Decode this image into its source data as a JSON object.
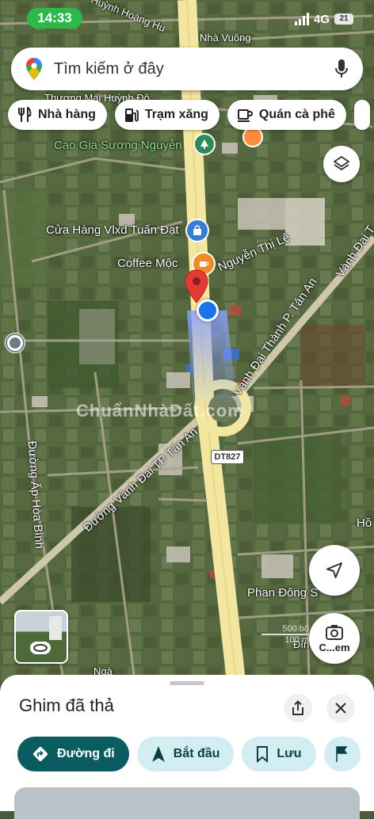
{
  "status_bar": {
    "time": "14:33",
    "network": "4G",
    "battery": "21"
  },
  "search": {
    "placeholder": "Tìm kiếm ở đây"
  },
  "chips": [
    {
      "label": "Nhà hàng",
      "icon": "fork-knife-icon"
    },
    {
      "label": "Trạm xăng",
      "icon": "gas-station-icon"
    },
    {
      "label": "Quán cà phê",
      "icon": "coffee-cup-icon"
    }
  ],
  "map": {
    "labels": {
      "huynh_hoang": "Huỳnh Hoàng Hu",
      "nha_vuong": "Nhà Vuông",
      "thuong_mai": "Thương Mại Huỳnh Đô",
      "cao_gia": "Cao Gia Sương Nguyễn",
      "cua_hang": "Cửa Hàng Vlxd Tuấn Đạt",
      "coffee": "Coffee Mộc",
      "nguyen_thi_le": "Nguyễn Thị Lệ",
      "vanh_dai_1": "Vành Đai Thành P. Tân An",
      "vanh_dai_2": "Vành Đai T",
      "vanh_dai_3": "Đường Vành Đai TP Tân An",
      "ap_hoa_binh": "Đường Ấp Hòa Bình",
      "phan_dong": "Phan Đông S",
      "ho": "Hồ",
      "dinh": "Đìn",
      "nga": "Ngà",
      "road_badge": "DT827",
      "scale_1": "500 bộ",
      "scale_2": "100 m"
    },
    "watermark": "ChuẩnNhàĐất.com",
    "camera_button": "C...em"
  },
  "sheet": {
    "title": "Ghim đã thả",
    "actions": [
      {
        "label": "Đường đi",
        "icon": "directions-icon"
      },
      {
        "label": "Bắt đầu",
        "icon": "navigation-arrow-icon"
      },
      {
        "label": "Lưu",
        "icon": "bookmark-icon"
      }
    ]
  },
  "colors": {
    "accent_teal": "#0b5c60",
    "chip_light": "#d3eef3",
    "pin_red": "#e53935",
    "blue_dot": "#1a73e8",
    "road_yellow": "#f3e6a0"
  }
}
